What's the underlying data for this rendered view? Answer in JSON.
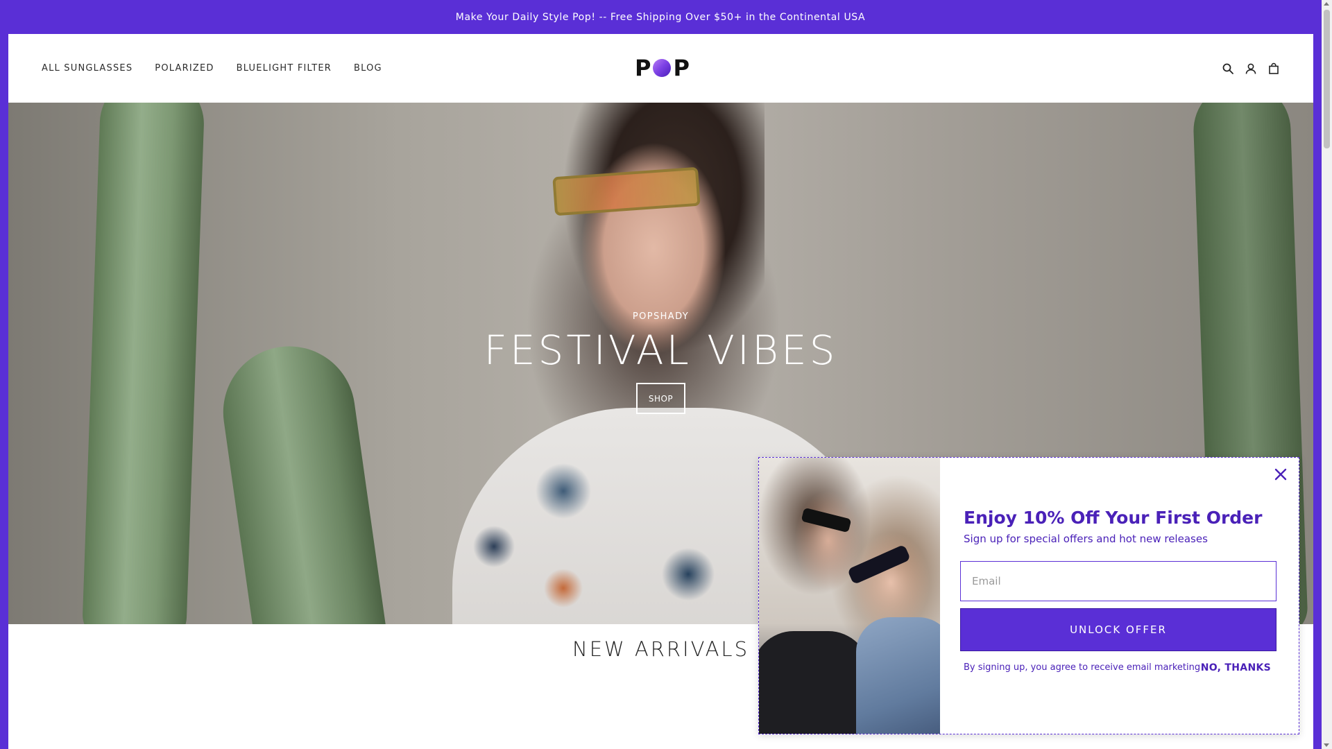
{
  "announcement": {
    "text": "Make Your Daily Style Pop! -- Free Shipping Over $50+ in the Continental USA"
  },
  "header": {
    "nav": [
      {
        "label": "ALL SUNGLASSES"
      },
      {
        "label": "POLARIZED"
      },
      {
        "label": "BLUELIGHT FILTER"
      },
      {
        "label": "BLOG"
      }
    ],
    "logo": {
      "left": "P",
      "right": "P"
    },
    "icons": [
      "search-icon",
      "account-icon",
      "cart-icon"
    ]
  },
  "hero": {
    "kicker": "POPSHADY",
    "title": "FESTIVAL VIBES",
    "button_label": "SHOP"
  },
  "sections": {
    "new_arrivals_title": "NEW ARRIVALS"
  },
  "popup": {
    "heading": "Enjoy 10% Off Your First Order",
    "subheading": "Sign up for special offers and hot new releases",
    "email_placeholder": "Email",
    "email_value": "",
    "cta_label": "UNLOCK OFFER",
    "legal": "By signing up, you agree to receive email marketing",
    "decline_label": "NO, THANKS"
  },
  "colors": {
    "brand_purple": "#5a2fd6",
    "popup_text": "#4a21b8"
  }
}
